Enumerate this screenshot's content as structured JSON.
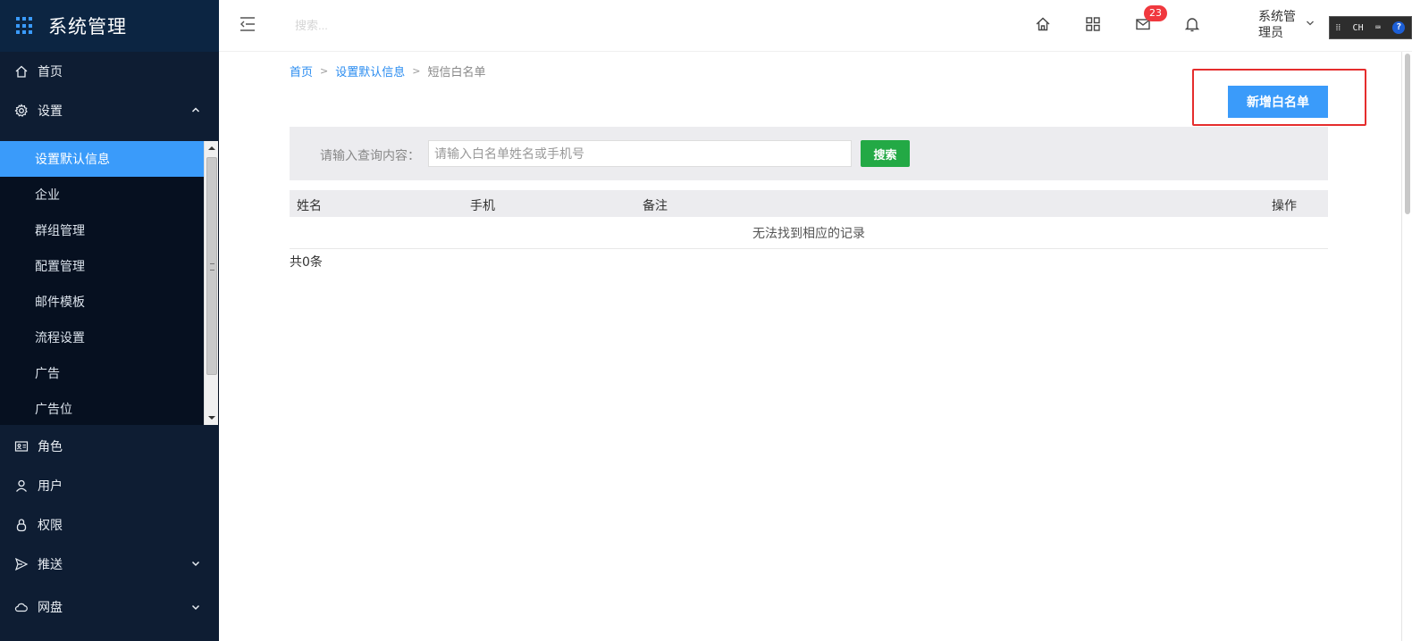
{
  "app": {
    "title": "系统管理"
  },
  "sidebar": {
    "items": [
      {
        "label": "首页",
        "icon": "home-icon"
      },
      {
        "label": "设置",
        "icon": "gear-icon",
        "expanded": true
      }
    ],
    "submenu": [
      {
        "label": "设置默认信息",
        "active": true
      },
      {
        "label": "企业"
      },
      {
        "label": "群组管理"
      },
      {
        "label": "配置管理"
      },
      {
        "label": "邮件模板"
      },
      {
        "label": "流程设置"
      },
      {
        "label": "广告"
      },
      {
        "label": "广告位"
      }
    ],
    "lower_items": [
      {
        "label": "角色",
        "icon": "id-card-icon"
      },
      {
        "label": "用户",
        "icon": "user-icon"
      },
      {
        "label": "权限",
        "icon": "lock-icon"
      },
      {
        "label": "推送",
        "icon": "send-icon",
        "chevron": "down"
      },
      {
        "label": "网盘",
        "icon": "cloud-icon",
        "chevron": "down"
      }
    ]
  },
  "header": {
    "search_placeholder": "搜索...",
    "mail_badge": "23",
    "user_name": "系统管理员",
    "ime": {
      "lang": "CH"
    }
  },
  "breadcrumb": {
    "items": [
      "首页",
      "设置默认信息"
    ],
    "separator": ">",
    "current": "短信白名单"
  },
  "actions": {
    "add_label": "新增白名单"
  },
  "filter": {
    "label": "请输入查询内容：",
    "placeholder": "请输入白名单姓名或手机号",
    "value": "",
    "search_label": "搜索"
  },
  "table": {
    "headers": [
      "姓名",
      "手机",
      "备注",
      "操作"
    ],
    "empty_text": "无法找到相应的记录",
    "total": "共0条"
  },
  "colors": {
    "sidebar_bg": "#0e1d33",
    "accent": "#3a9bfa",
    "search_btn": "#23a945",
    "badge": "#f0383e",
    "highlight": "#e52d2d"
  }
}
